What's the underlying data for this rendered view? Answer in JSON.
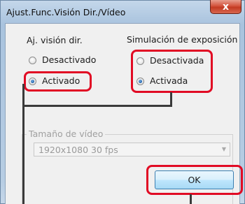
{
  "window": {
    "title": "Ajust.Func.Visión Dir./Vídeo",
    "close_label": "x"
  },
  "live_view": {
    "label": "Aj. visión dir.",
    "options": [
      {
        "label": "Desactivado",
        "checked": false
      },
      {
        "label": "Activado",
        "checked": true
      }
    ]
  },
  "exposure_sim": {
    "label": "Simulación de exposición",
    "options": [
      {
        "label": "Desactivada",
        "checked": false
      },
      {
        "label": "Activada",
        "checked": true
      }
    ]
  },
  "video_size": {
    "label": "Tamaño de vídeo",
    "selected": "1920x1080  30 fps",
    "disabled": true
  },
  "ok_button": {
    "label": "OK"
  },
  "annotation": {
    "highlight_color": "#e10b24",
    "connector_color": "#3a3a3a"
  }
}
